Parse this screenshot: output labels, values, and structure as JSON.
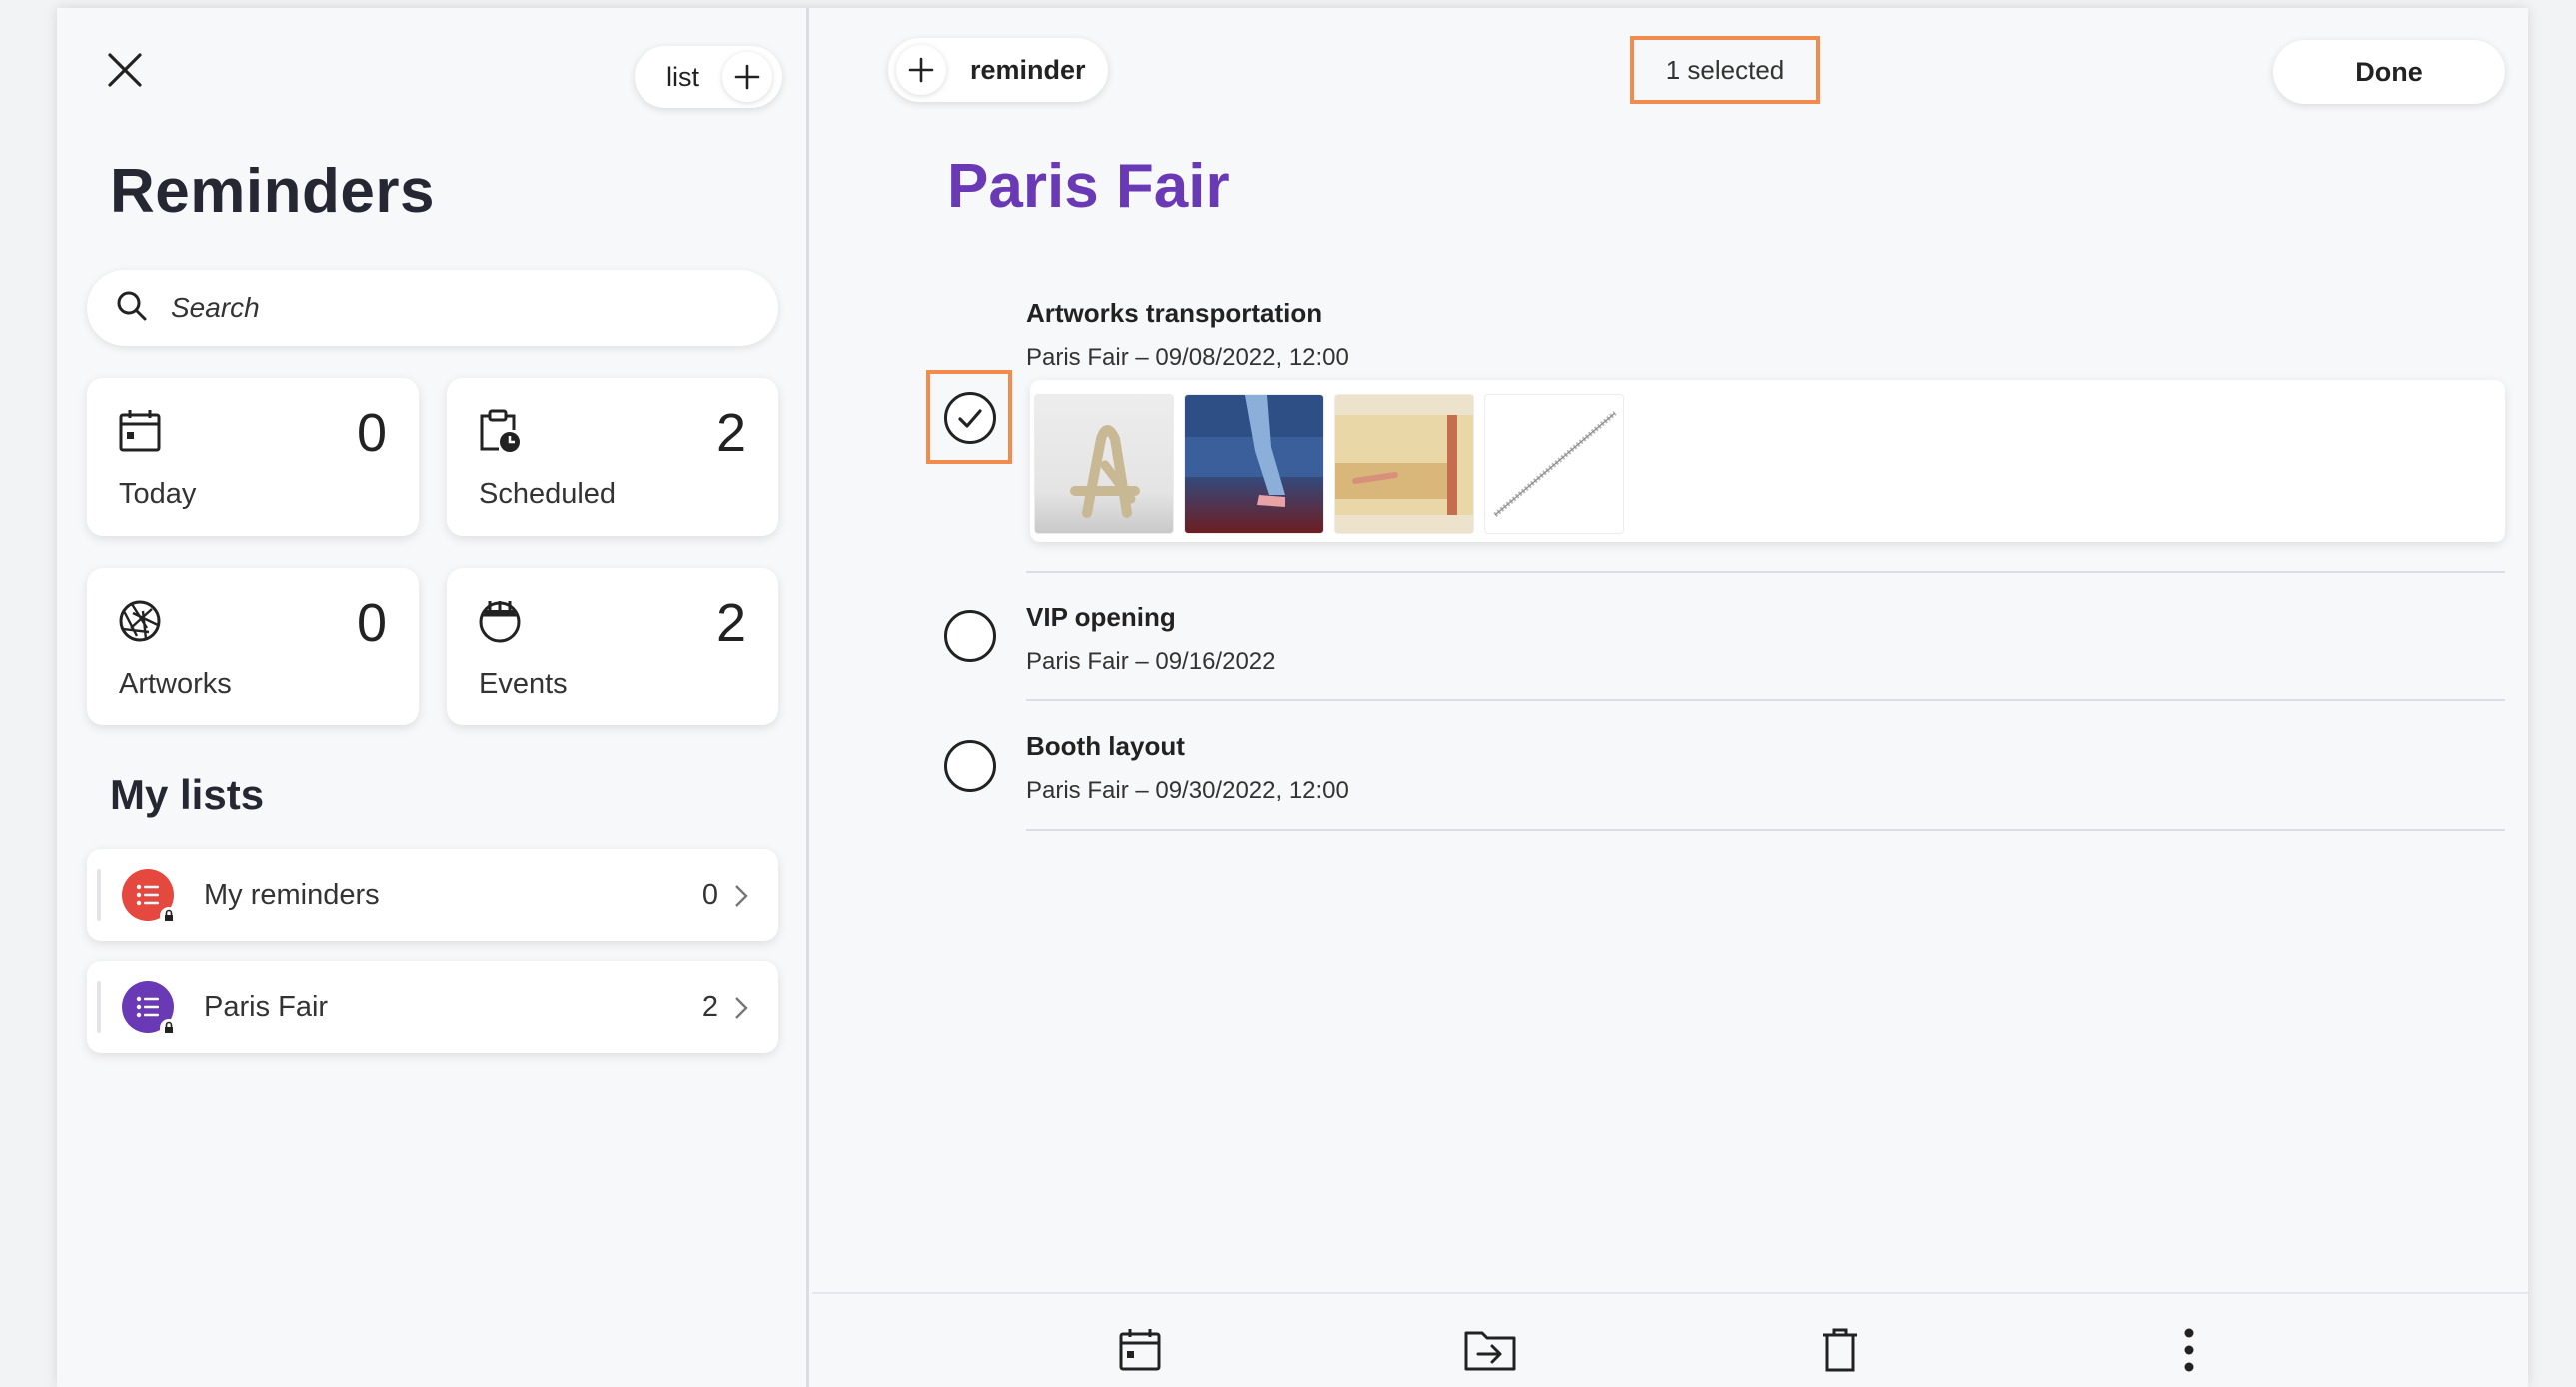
{
  "sidebar": {
    "list_button_label": "list",
    "title": "Reminders",
    "search": {
      "placeholder": "Search",
      "value": ""
    },
    "smart_lists": [
      {
        "label": "Today",
        "count": "0",
        "icon": "calendar-icon"
      },
      {
        "label": "Scheduled",
        "count": "2",
        "icon": "clipboard-clock-icon"
      },
      {
        "label": "Artworks",
        "count": "0",
        "icon": "aperture-icon"
      },
      {
        "label": "Events",
        "count": "2",
        "icon": "calendar-round-icon"
      }
    ],
    "my_lists_title": "My lists",
    "my_lists": [
      {
        "name": "My reminders",
        "count": "0",
        "color": "#e5483f"
      },
      {
        "name": "Paris Fair",
        "count": "2",
        "color": "#6a3ab6"
      }
    ]
  },
  "main": {
    "add_reminder_label": "reminder",
    "selected_label": "1 selected",
    "done_label": "Done",
    "list_title": "Paris Fair",
    "list_title_color": "#6a3ab6",
    "items": [
      {
        "title": "Artworks transportation",
        "subtitle": "Paris Fair – 09/08/2022, 12:00",
        "checked": true,
        "attachments": 4
      },
      {
        "title": "VIP opening",
        "subtitle": "Paris Fair – 09/16/2022",
        "checked": false
      },
      {
        "title": "Booth layout",
        "subtitle": "Paris Fair – 09/30/2022, 12:00",
        "checked": false
      }
    ]
  },
  "toolbar": {
    "buttons": [
      "calendar-icon",
      "move-to-folder-icon",
      "trash-icon",
      "more-vertical-icon"
    ]
  },
  "colors": {
    "highlight": "#f28b4c",
    "accent": "#6a3ab6"
  }
}
